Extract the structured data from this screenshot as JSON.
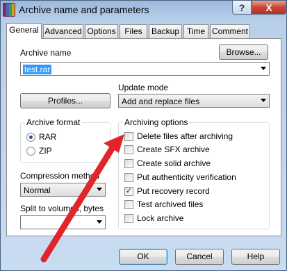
{
  "window": {
    "title": "Archive name and parameters",
    "help_glyph": "?",
    "close_glyph": "X"
  },
  "tabs": [
    {
      "label": "General",
      "active": true
    },
    {
      "label": "Advanced"
    },
    {
      "label": "Options"
    },
    {
      "label": "Files"
    },
    {
      "label": "Backup"
    },
    {
      "label": "Time"
    },
    {
      "label": "Comment"
    }
  ],
  "archive_name": {
    "label": "Archive name",
    "browse_label": "Browse...",
    "value": "test.rar"
  },
  "profiles_label": "Profiles...",
  "update_mode": {
    "label": "Update mode",
    "value": "Add and replace files"
  },
  "archive_format": {
    "label": "Archive format",
    "options": [
      {
        "label": "RAR",
        "selected": true
      },
      {
        "label": "ZIP",
        "selected": false
      }
    ]
  },
  "compression": {
    "label": "Compression method",
    "value": "Normal"
  },
  "split": {
    "label": "Split to volumes, bytes",
    "value": ""
  },
  "archiving_options": {
    "label": "Archiving options",
    "items": [
      {
        "label": "Delete files after archiving",
        "checked": false
      },
      {
        "label": "Create SFX archive",
        "checked": false
      },
      {
        "label": "Create solid archive",
        "checked": false
      },
      {
        "label": "Put authenticity verification",
        "checked": false
      },
      {
        "label": "Put recovery record",
        "checked": true
      },
      {
        "label": "Test archived files",
        "checked": false
      },
      {
        "label": "Lock archive",
        "checked": false
      }
    ]
  },
  "buttons": {
    "ok": "OK",
    "cancel": "Cancel",
    "help": "Help"
  },
  "check_glyph": "✓",
  "colors": {
    "annotation_arrow": "#e0252b",
    "selection": "#3399ff",
    "close_button": "#c7463a"
  }
}
